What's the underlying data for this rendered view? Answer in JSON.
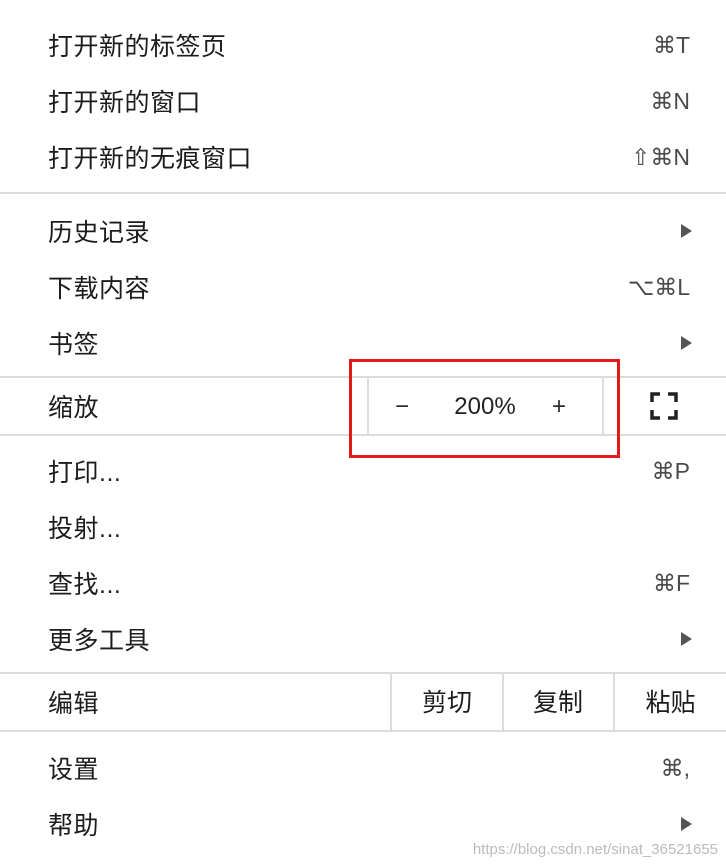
{
  "menu": {
    "new_tab": {
      "label": "打开新的标签页",
      "shortcut": "⌘T"
    },
    "new_window": {
      "label": "打开新的窗口",
      "shortcut": "⌘N"
    },
    "new_incognito": {
      "label": "打开新的无痕窗口",
      "shortcut": "⇧⌘N"
    },
    "history": {
      "label": "历史记录"
    },
    "downloads": {
      "label": "下载内容",
      "shortcut": "⌥⌘L"
    },
    "bookmarks": {
      "label": "书签"
    },
    "zoom": {
      "label": "缩放",
      "minus": "−",
      "value": "200%",
      "plus": "+"
    },
    "print": {
      "label": "打印...",
      "shortcut": "⌘P"
    },
    "cast": {
      "label": "投射..."
    },
    "find": {
      "label": "查找...",
      "shortcut": "⌘F"
    },
    "more_tools": {
      "label": "更多工具"
    },
    "edit": {
      "label": "编辑",
      "cut": "剪切",
      "copy": "复制",
      "paste": "粘贴"
    },
    "settings": {
      "label": "设置",
      "shortcut": "⌘,"
    },
    "help": {
      "label": "帮助"
    }
  },
  "icons": {
    "submenu": "chevron-right-icon",
    "fullscreen": "fullscreen-icon"
  },
  "colors": {
    "highlight_border": "#e41a1a",
    "separator": "#dcdcdc"
  },
  "watermark": "https://blog.csdn.net/sinat_36521655"
}
